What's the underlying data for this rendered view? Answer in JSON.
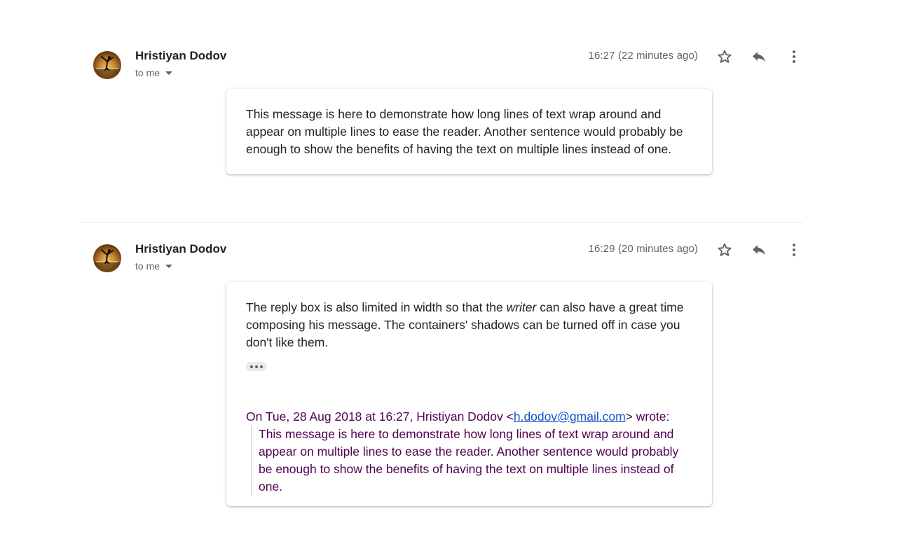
{
  "messages": [
    {
      "sender": "Hristiyan Dodov",
      "recipient": "to me",
      "timestamp": "16:27 (22 minutes ago)",
      "body": "This message is here to demonstrate how long lines of text wrap around and appear on multiple lines to ease the reader. Another sentence would probably be enough to show the benefits of having the text on multiple lines instead of one."
    },
    {
      "sender": "Hristiyan Dodov",
      "recipient": "to me",
      "timestamp": "16:29 (20 minutes ago)",
      "body_before_emphasis": "The reply box is also limited in width so that the ",
      "body_emphasis": "writer",
      "body_after_emphasis": " can also have a great time composing his message. The containers' shadows can be turned off in case you don't like them.",
      "quote": {
        "attribution_prefix": "On Tue, 28 Aug 2018 at 16:27, Hristiyan Dodov <",
        "email": "h.dodov@gmail.com",
        "attribution_suffix": "> wrote:",
        "text": "This message is here to demonstrate how long lines of text wrap around and appear on multiple lines to ease the reader. Another sentence would probably be enough to show the benefits of having the text on multiple lines instead of one."
      }
    }
  ],
  "icons": {
    "star": "star-icon",
    "reply": "reply-icon",
    "more": "more-vert-icon",
    "expand": "expand-arrow-icon",
    "ellipsis": "ellipsis-icon"
  },
  "colors": {
    "text": "#222222",
    "secondary": "#5f6368",
    "quoted_text": "#500050",
    "link": "#1155cc",
    "divider": "#ebebeb"
  }
}
